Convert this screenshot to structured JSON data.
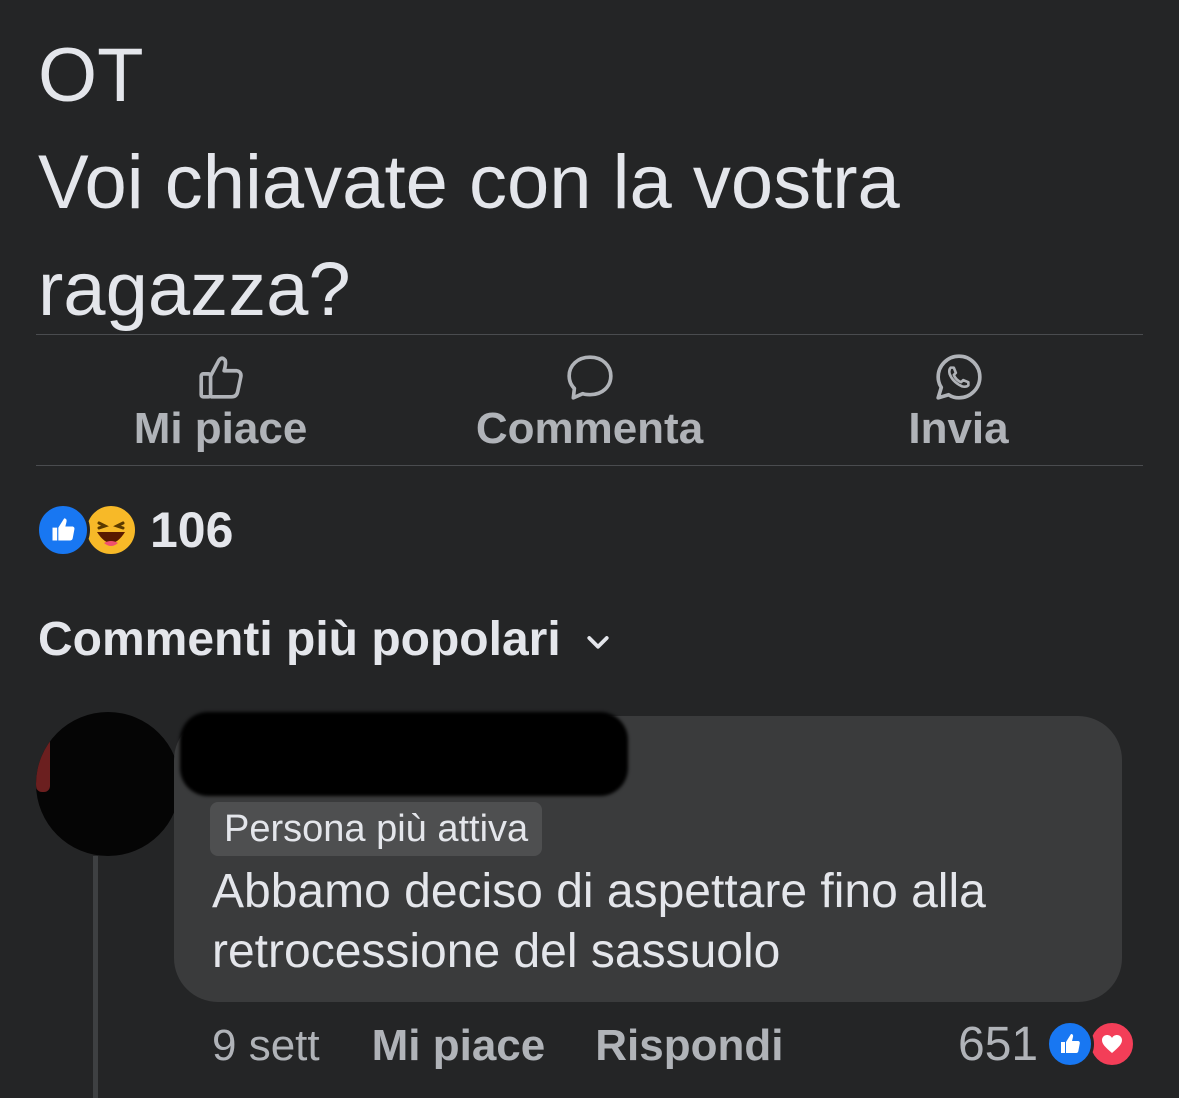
{
  "post": {
    "lines": [
      "OT",
      "Voi chiavate con la vostra",
      "ragazza?"
    ]
  },
  "actions": {
    "like": {
      "label": "Mi piace",
      "icon": "thumbs-up-outline-icon"
    },
    "comment": {
      "label": "Commenta",
      "icon": "comment-bubble-icon"
    },
    "send": {
      "label": "Invia",
      "icon": "whatsapp-icon"
    }
  },
  "reactions": {
    "count": "106",
    "icons": [
      "like-reaction-icon",
      "haha-reaction-icon"
    ]
  },
  "comments_sort": {
    "label": "Commenti più popolari",
    "icon": "chevron-down-icon"
  },
  "comment": {
    "badge": "Persona più attiva",
    "text_lines": [
      "Abbamo deciso di aspettare fino alla",
      "retrocessione del sassuolo"
    ],
    "time": "9 sett",
    "like_label": "Mi piace",
    "reply_label": "Rispondi",
    "reaction_count": "651",
    "reaction_icons": [
      "like-reaction-icon",
      "love-reaction-icon"
    ]
  },
  "colors": {
    "background": "#242526",
    "bubble": "#3a3b3c",
    "like_blue": "#1877f2",
    "love_red": "#f33e58",
    "haha_yellow": "#f7b928"
  }
}
